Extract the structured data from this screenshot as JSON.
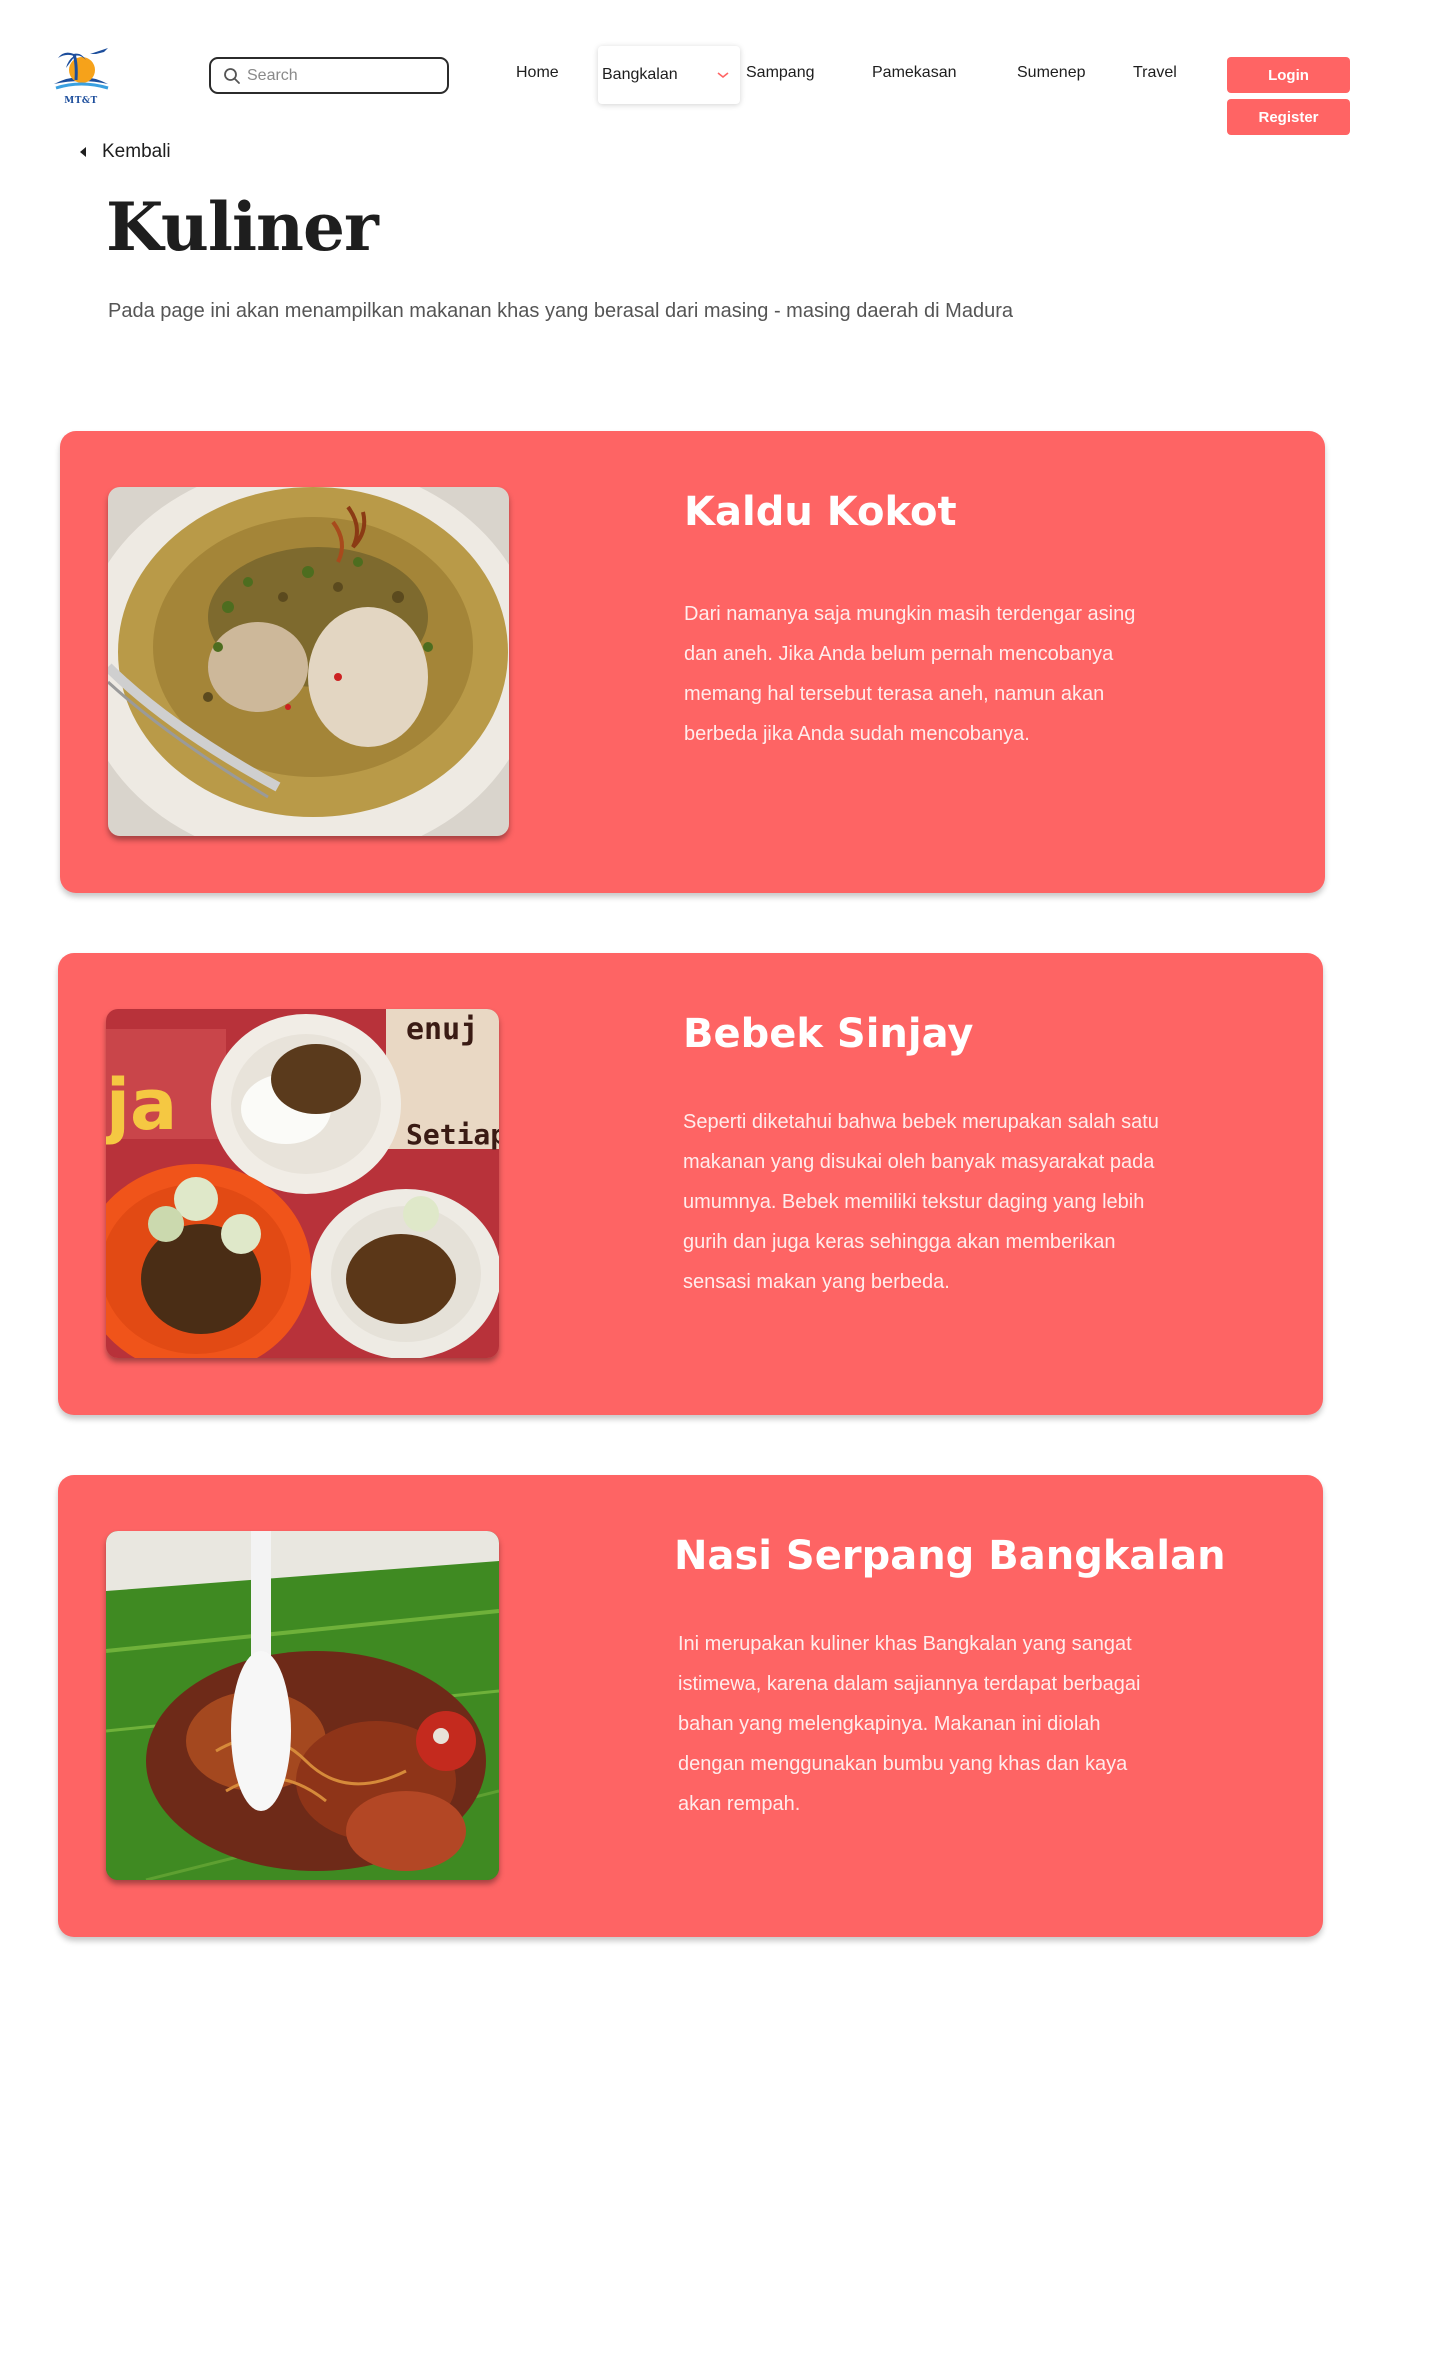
{
  "header": {
    "logo_text": "MT&T",
    "search": {
      "placeholder": "Search"
    },
    "nav": [
      {
        "label": "Home"
      },
      {
        "label": "Bangkalan"
      },
      {
        "label": "Sampang"
      },
      {
        "label": "Pamekasan"
      },
      {
        "label": "Sumenep"
      },
      {
        "label": "Travel"
      }
    ],
    "login_label": "Login",
    "register_label": "Register"
  },
  "back_label": "Kembali",
  "page": {
    "title": "Kuliner",
    "description": "Pada page ini akan menampilkan makanan khas yang berasal dari masing - masing daerah di Madura"
  },
  "cards": [
    {
      "title": "Kaldu Kokot",
      "text": "Dari namanya saja mungkin masih terdengar asing dan aneh. Jika Anda belum pernah mencobanya memang hal tersebut terasa aneh, namun akan berbeda jika Anda sudah mencobanya.",
      "image": "kaldu-kokot-photo"
    },
    {
      "title": "Bebek Sinjay",
      "text": "Seperti diketahui bahwa bebek merupakan salah satu makanan yang disukai oleh banyak masyarakat pada umumnya. Bebek memiliki tekstur daging yang lebih gurih dan juga keras sehingga akan memberikan sensasi makan yang berbeda.",
      "image": "bebek-sinjay-photo"
    },
    {
      "title": "Nasi Serpang Bangkalan",
      "text": "Ini merupakan kuliner khas Bangkalan yang sangat istimewa, karena dalam sajiannya terdapat berbagai bahan yang melengkapinya. Makanan ini diolah dengan menggunakan bumbu yang khas dan kaya akan rempah.",
      "image": "nasi-serpang-photo"
    }
  ],
  "colors": {
    "accent": "#fe6464",
    "text_dark": "#1e1e1e",
    "text_muted": "#555555"
  }
}
